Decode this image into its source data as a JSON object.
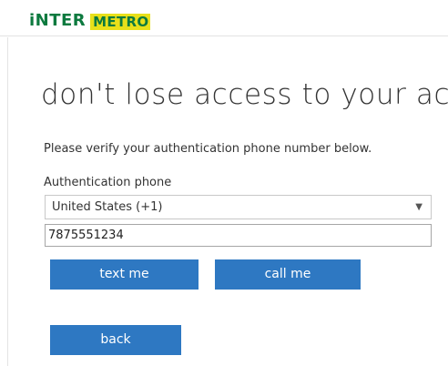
{
  "brand": {
    "name_part1": "iNTER",
    "name_part2": "METRO"
  },
  "page": {
    "title": "don't lose access to your ac",
    "instruction": "Please verify your authentication phone number below.",
    "phone_label": "Authentication phone"
  },
  "form": {
    "country_selected": "United States (+1)",
    "phone_value": "7875551234"
  },
  "buttons": {
    "text_me": "text me",
    "call_me": "call me",
    "back": "back"
  },
  "colors": {
    "button_blue": "#2e78c2",
    "brand_green": "#0d7a3f",
    "brand_yellow": "#e8e01a"
  }
}
